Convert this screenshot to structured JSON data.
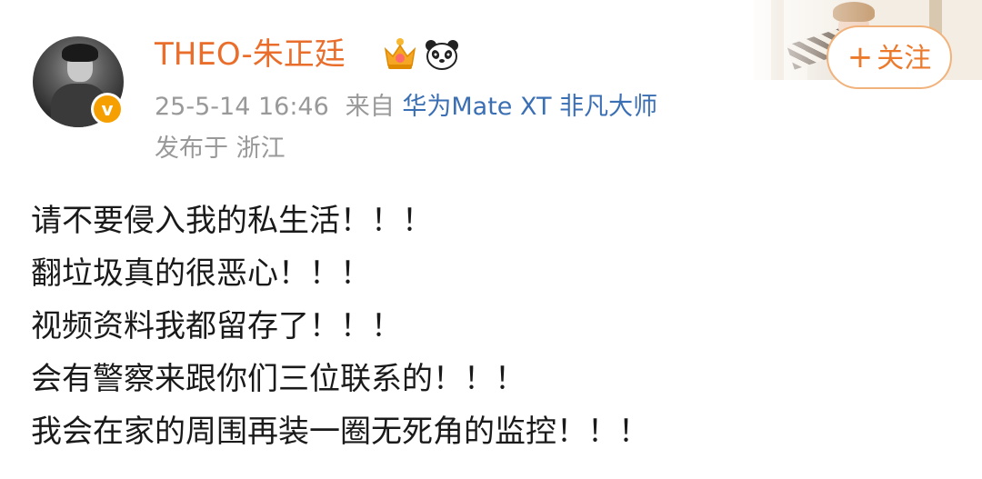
{
  "post": {
    "author": {
      "username": "THEO-朱正廷",
      "badges": [
        "crown-icon",
        "panda-icon"
      ],
      "verified_icon": "verified-v-icon",
      "verified_glyph": "v"
    },
    "meta": {
      "timestamp": "25-5-14 16:46",
      "source_prefix": "来自",
      "device": "华为Mate XT 非凡大师",
      "location": "发布于 浙江"
    },
    "follow_button": {
      "plus": "+",
      "label": "关注"
    },
    "content_lines": [
      "请不要侵入我的私生活！！！",
      "翻垃圾真的很恶心！！！",
      "视频资料我都留存了！！！",
      "会有警察来跟你们三位联系的！！！",
      "我会在家的周围再装一圈无死角的监控！！！"
    ]
  },
  "colors": {
    "username": "#e96d2b",
    "meta": "#999999",
    "device_link": "#3b6fb4",
    "follow_border": "#f1b27b",
    "follow_text": "#ec7a2d",
    "verified_badge": "#f5a000",
    "body_text": "#1a1a1a"
  }
}
